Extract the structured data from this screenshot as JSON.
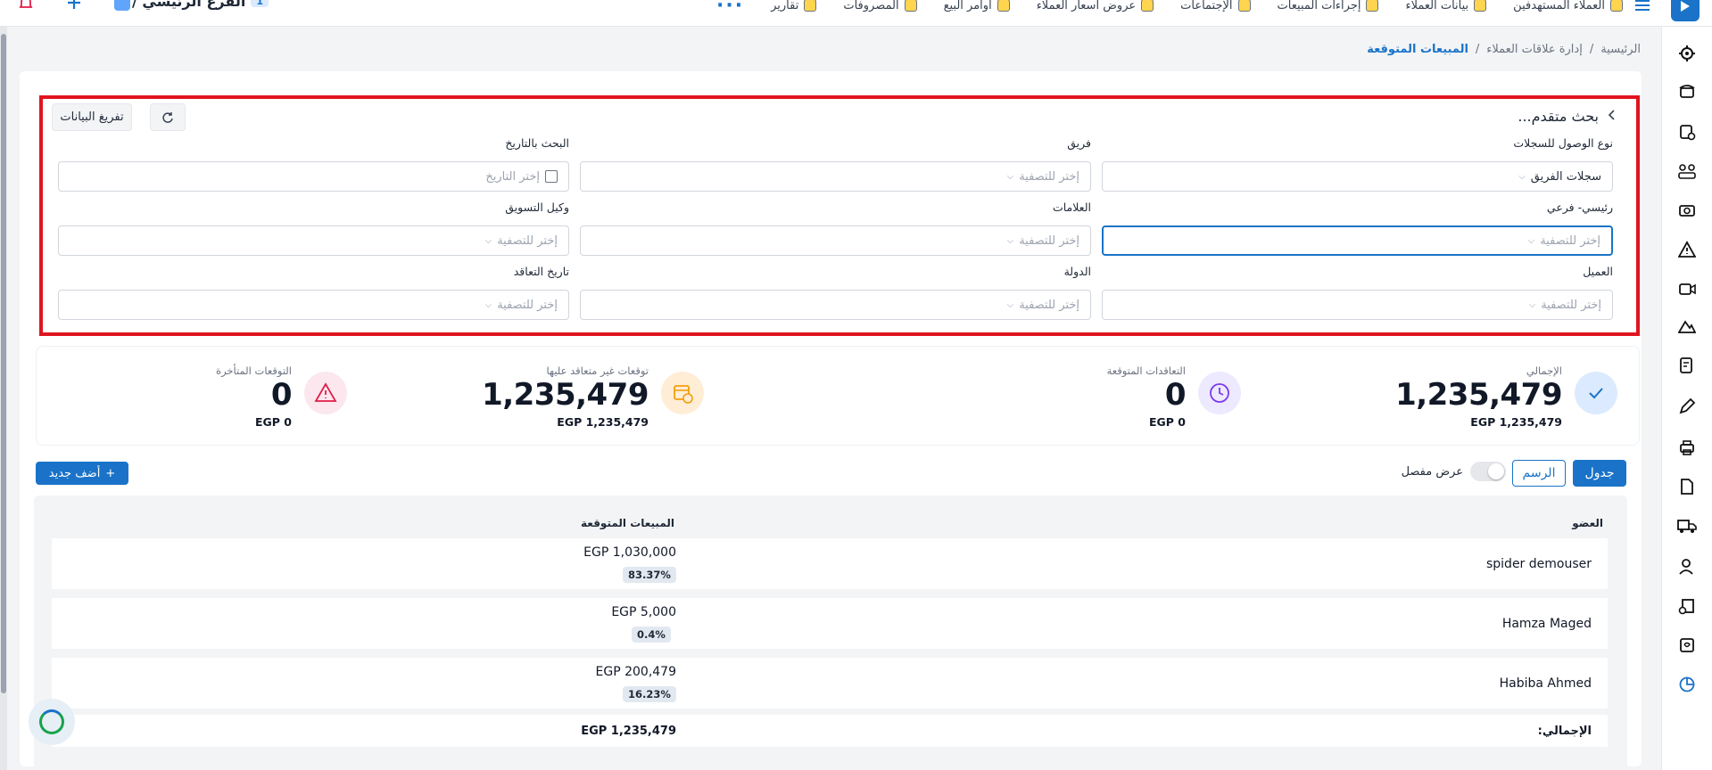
{
  "topbar": {
    "branch_label": "الفرع الرئيسي /",
    "branch_badge": "1",
    "nav": [
      {
        "label": "العملاء المستهدفين",
        "icon": "users-target-icon"
      },
      {
        "label": "بيانات العملاء",
        "icon": "customer-data-icon"
      },
      {
        "label": "إجراءات المبيعات",
        "icon": "phone-icon"
      },
      {
        "label": "الإجتماعات",
        "icon": "meeting-icon"
      },
      {
        "label": "عروض أسعار العملاء",
        "icon": "quote-icon"
      },
      {
        "label": "أوامر البيع",
        "icon": "sales-order-icon"
      },
      {
        "label": "المصروفات",
        "icon": "expenses-icon"
      },
      {
        "label": "تقارير",
        "icon": "report-icon"
      }
    ],
    "more": "···"
  },
  "breadcrumb": {
    "home": "الرئيسية",
    "section": "إدارة علاقات العملاء",
    "current": "المبيعات المتوقعة",
    "sep": "/"
  },
  "filters": {
    "title": "بحث متقدم...",
    "reset_label": "تفريغ البيانات",
    "access_type": {
      "label": "نوع الوصول للسجلات",
      "value": "سجلات الفريق"
    },
    "team": {
      "label": "فريق",
      "placeholder": "إختر للتصفية"
    },
    "date_search": {
      "label": "البحث بالتاريخ",
      "placeholder": "إختر التاريخ"
    },
    "main_sub": {
      "label": "رئيسي- فرعي",
      "placeholder": "إختر للتصفية"
    },
    "tags": {
      "label": "العلامات",
      "placeholder": "إختر للتصفية"
    },
    "marketing_agent": {
      "label": "وكيل التسويق",
      "placeholder": "إختر للتصفية"
    },
    "customer": {
      "label": "العميل",
      "placeholder": "إختر للتصفية"
    },
    "country": {
      "label": "الدولة",
      "placeholder": "إختر للتصفية"
    },
    "contract_date": {
      "label": "تاريخ التعاقد",
      "placeholder": "إختر للتصفية"
    }
  },
  "stats": [
    {
      "label": "الإجمالي",
      "value": "1,235,479",
      "sub": "EGP 1,235,479",
      "icon": "check-icon",
      "color": "#dbeafe",
      "icon_color": "#1a73c8"
    },
    {
      "label": "التعاقدات المتوقعة",
      "value": "0",
      "sub": "EGP 0",
      "icon": "clock-icon",
      "color": "#ede9fe",
      "icon_color": "#7c3aed"
    },
    {
      "label": "توقعات غير متعاقد عليها",
      "value": "1,235,479",
      "sub": "EGP 1,235,479",
      "icon": "calendar-clock-icon",
      "color": "#ffedd5",
      "icon_color": "#f59e0b"
    },
    {
      "label": "التوقعات المتأخرة",
      "value": "0",
      "sub": "EGP 0",
      "icon": "warning-icon",
      "color": "#fce7ef",
      "icon_color": "#e11d48"
    }
  ],
  "controls": {
    "table_label": "جدول",
    "chart_label": "الرسم",
    "detailed_view_label": "عرض مفصل",
    "add_new_label": "أضف جديد"
  },
  "table": {
    "col_member": "العضو",
    "col_expected_sales": "المبيعات المتوقعة",
    "rows": [
      {
        "member": "spider demouser",
        "amount": "EGP 1,030,000",
        "pct": "83.37%"
      },
      {
        "member": "Hamza Maged",
        "amount": "EGP 5,000",
        "pct": "0.4%"
      },
      {
        "member": "Habiba Ahmed",
        "amount": "EGP 200,479",
        "pct": "16.23%"
      }
    ],
    "total_label": "الإجمالي:",
    "total_value": "EGP 1,235,479"
  }
}
